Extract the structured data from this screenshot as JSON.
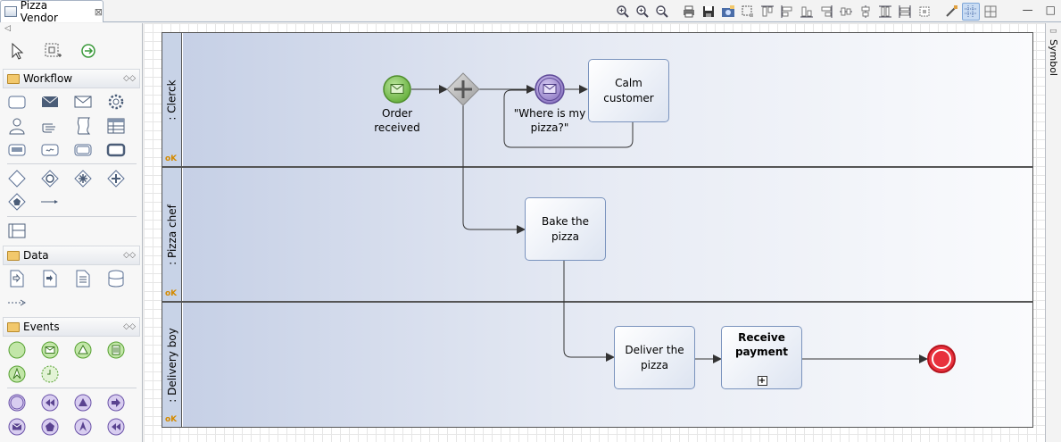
{
  "editor": {
    "tab_title": "Pizza Vendor",
    "tab_close": "⊠",
    "window_minimize": "—",
    "window_maximize": "□"
  },
  "palette": {
    "collapse_arrow": "◁",
    "sections": [
      {
        "label": "Workflow",
        "toggle": "◇◇"
      },
      {
        "label": "Data",
        "toggle": "◇◇"
      },
      {
        "label": "Events",
        "toggle": "◇◇"
      }
    ]
  },
  "diagram": {
    "lanes": [
      {
        "label": ": Clerck"
      },
      {
        "label": ": Pizza chef"
      },
      {
        "label": ": Delivery boy"
      }
    ],
    "events": {
      "order_received": "Order\nreceived",
      "where_is_pizza": "\"Where is my\npizza?\""
    },
    "tasks": {
      "calm_customer": "Calm\ncustomer",
      "bake_pizza": "Bake the pizza",
      "deliver_pizza": "Deliver the\npizza",
      "receive_payment": "Receive\npayment",
      "subprocess_marker": "+"
    },
    "colors": {
      "start_event": "#7fc85a",
      "intermediate_event": "#9a86c8",
      "end_event": "#e8313d",
      "gateway": "#a8a8a8",
      "task_border": "#7a93bd",
      "lane_header": "#c8d3e7"
    }
  },
  "right_view": {
    "label": "Symbol"
  }
}
